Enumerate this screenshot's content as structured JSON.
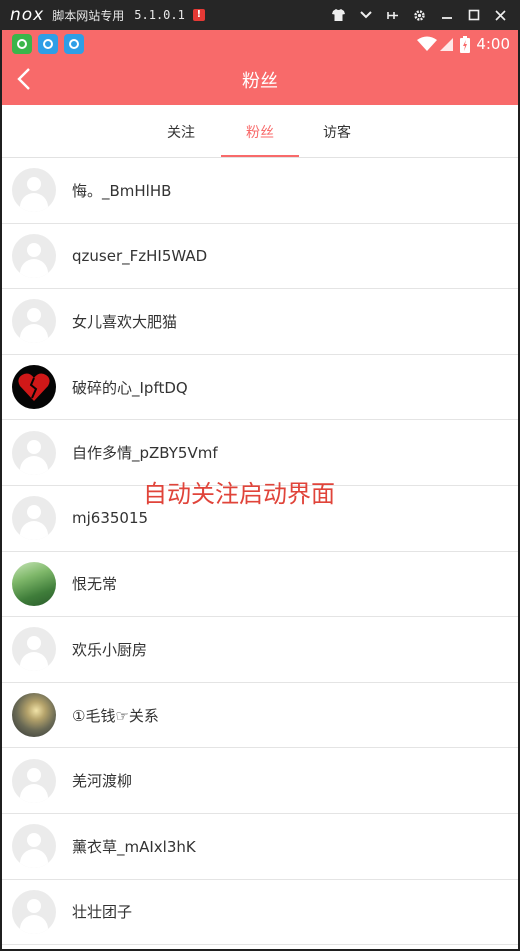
{
  "emulator": {
    "logo": "nox",
    "title": "脚本网站专用",
    "version": "5.1.0.1",
    "alert": "!",
    "controls": [
      "shirt-icon",
      "chevron-down-icon",
      "pin-icon",
      "gear-icon",
      "minimize-icon",
      "maximize-icon",
      "close-icon"
    ]
  },
  "status_bar": {
    "time": "4:00",
    "notifications": [
      "app-green-icon",
      "app-blue-icon",
      "app-blue-icon"
    ]
  },
  "header": {
    "title": "粉丝",
    "background": "#f86a6a"
  },
  "tabs": [
    {
      "label": "关注",
      "active": false
    },
    {
      "label": "粉丝",
      "active": true
    },
    {
      "label": "访客",
      "active": false
    }
  ],
  "followers": [
    {
      "name": "悔。_BmHlHB",
      "avatar": "default"
    },
    {
      "name": "qzuser_FzHI5WAD",
      "avatar": "default"
    },
    {
      "name": "女儿喜欢大肥猫",
      "avatar": "default"
    },
    {
      "name": "破碎的心_IpftDQ",
      "avatar": "broken-heart"
    },
    {
      "name": "自作多情_pZBY5Vmf",
      "avatar": "default"
    },
    {
      "name": "mj635015",
      "avatar": "default"
    },
    {
      "name": "恨无常",
      "avatar": "forest"
    },
    {
      "name": "欢乐小厨房",
      "avatar": "default"
    },
    {
      "name": "①毛钱☞关系",
      "avatar": "sunset"
    },
    {
      "name": "羌河渡柳",
      "avatar": "default"
    },
    {
      "name": "薰衣草_mAIxl3hK",
      "avatar": "default"
    },
    {
      "name": "壮壮团子",
      "avatar": "default"
    }
  ],
  "overlay_text": "自动关注启动界面"
}
